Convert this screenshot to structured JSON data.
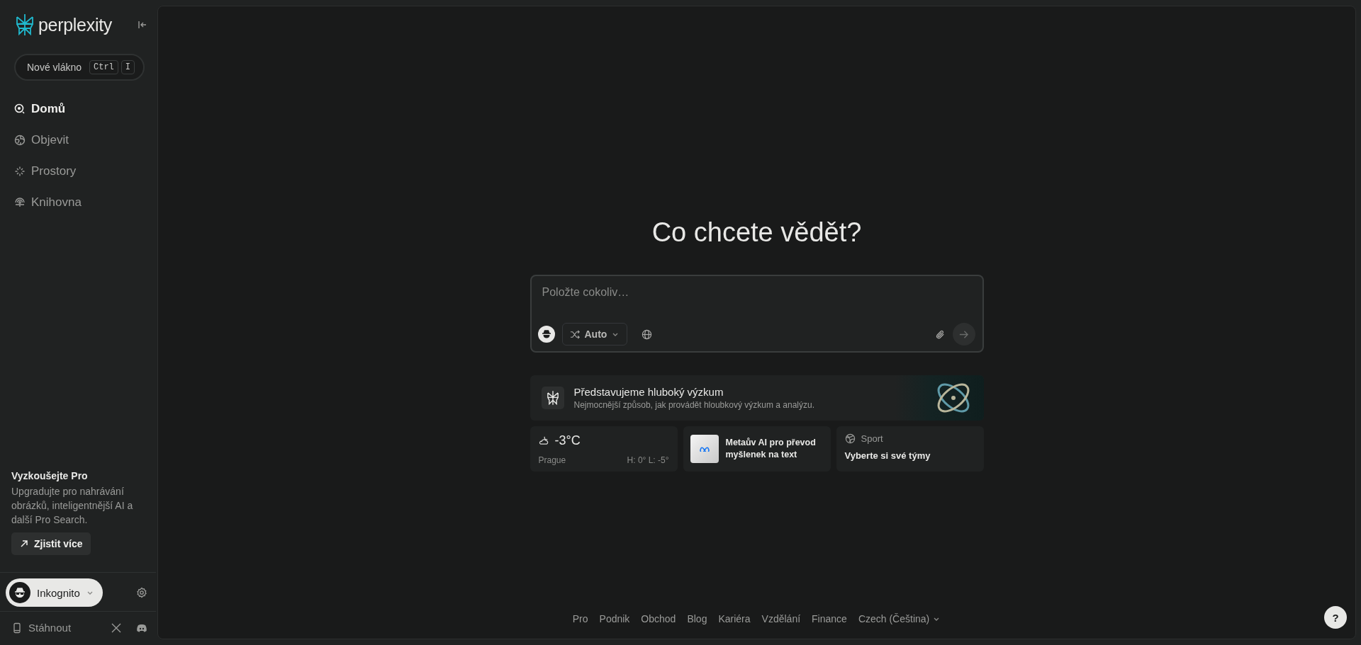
{
  "sidebar": {
    "logo": "perplexity",
    "new_thread": {
      "label": "Nové vlákno",
      "keys": [
        "Ctrl",
        "I"
      ]
    },
    "nav": [
      {
        "label": "Domů",
        "selected": true
      },
      {
        "label": "Objevit",
        "selected": false
      },
      {
        "label": "Prostory",
        "selected": false
      },
      {
        "label": "Knihovna",
        "selected": false
      }
    ],
    "promo": {
      "title": "Vyzkoušejte Pro",
      "text": "Upgradujte pro nahrávání obrázků, inteligentnější AI a další Pro Search.",
      "button": "Zjistit více"
    },
    "profile": {
      "name": "Inkognito"
    },
    "download": "Stáhnout"
  },
  "main": {
    "heading": "Co chcete vědět?",
    "search": {
      "placeholder": "Položte cokoliv…",
      "mode": "Auto"
    },
    "banner": {
      "title": "Představujeme hluboký výzkum",
      "subtitle": "Nejmocnější způsob, jak provádět hloubkový výzkum a analýzu."
    },
    "widgets": [
      {
        "kind": "weather",
        "temperature": "-3°C",
        "city": "Prague",
        "range": "H: 0° L: -5°"
      },
      {
        "kind": "news",
        "title": "Metaův AI pro převod myšlenek na text"
      },
      {
        "kind": "sport",
        "label": "Sport",
        "title": "Vyberte si své týmy"
      }
    ]
  },
  "footer": {
    "links": [
      "Pro",
      "Podnik",
      "Obchod",
      "Blog",
      "Kariéra",
      "Vzdělání",
      "Finance"
    ],
    "language": "Czech (Čeština)"
  },
  "help": "?"
}
